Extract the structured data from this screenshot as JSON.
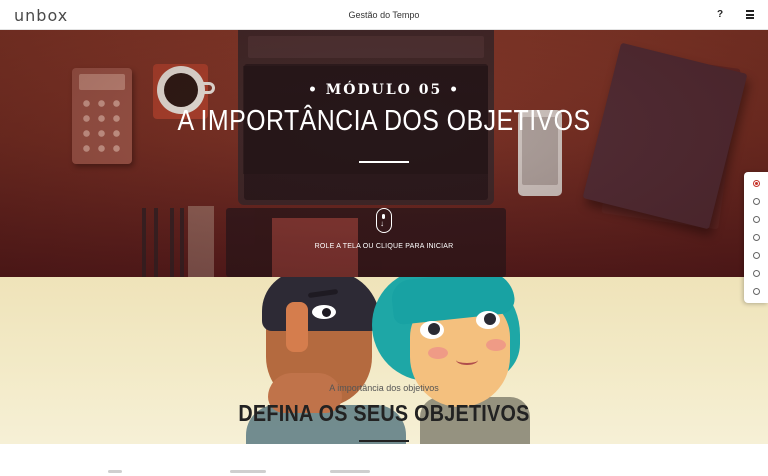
{
  "header": {
    "logo": "unbox",
    "course_title": "Gestão do Tempo",
    "help_label": "?"
  },
  "hero": {
    "module_label": "• MÓDULO 05 •",
    "title": "A IMPORTÂNCIA DOS OBJETIVOS",
    "cta": "ROLE A TELA OU CLIQUE PARA INICIAR"
  },
  "section2": {
    "subtitle": "A importância dos objetivos",
    "title": "DEFINA OS SEUS OBJETIVOS"
  },
  "sidenav": {
    "count": 6,
    "active_index": 0
  },
  "colors": {
    "hero_bg": "#7a3226",
    "section2_bg": "#f3ebc9",
    "active_dot": "#c7352b"
  }
}
